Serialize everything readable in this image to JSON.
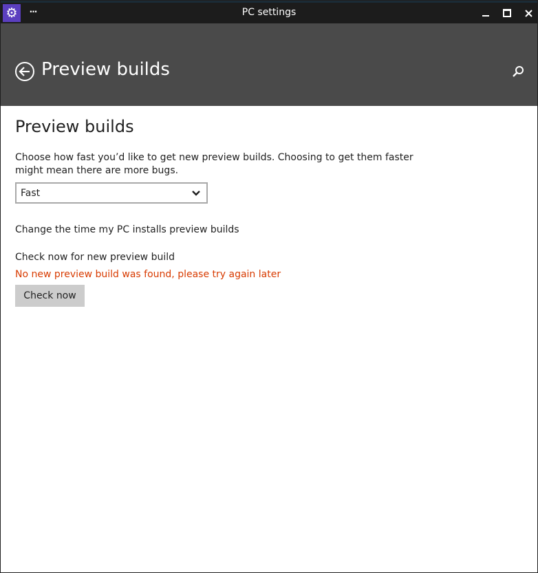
{
  "window": {
    "title": "PC settings",
    "more_label": "···",
    "app_icon": "gear-icon"
  },
  "header": {
    "title": "Preview builds",
    "back_icon": "back-arrow-icon",
    "search_icon": "search-icon"
  },
  "main": {
    "heading": "Preview builds",
    "description": "Choose how fast you’d like to get new preview builds. Choosing to get them faster might mean there are more bugs.",
    "speed_select": {
      "selected": "Fast"
    },
    "install_time_link": "Change the time my PC installs preview builds",
    "check_label": "Check now for new preview build",
    "status_message": "No new preview build was found, please try again later",
    "check_button": "Check now"
  },
  "colors": {
    "titlebar": "#1c1c1c",
    "header": "#4a4a4a",
    "accent_icon": "#5b3fbf",
    "error_text": "#d83b01",
    "button_bg": "#cccccc"
  }
}
